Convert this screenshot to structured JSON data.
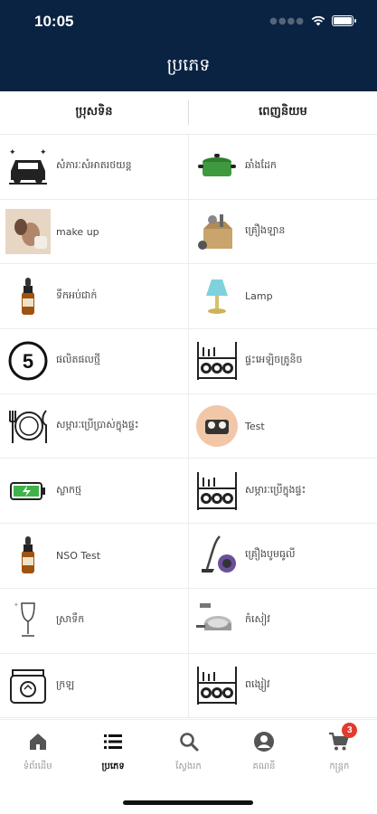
{
  "status_bar": {
    "time": "10:05"
  },
  "header": {
    "title": "ប្រភេទ"
  },
  "tabs": [
    {
      "label": "ប្រុសទិន"
    },
    {
      "label": "ពេញនិយម"
    }
  ],
  "categories": [
    {
      "label": "សំភារៈសំអាតរថយន្ត",
      "icon": "car-wash-icon"
    },
    {
      "label": "ឆាំងដែក",
      "icon": "cooking-pot-icon"
    },
    {
      "label": "make up",
      "icon": "makeup-brush-icon"
    },
    {
      "label": "គ្រឿងឡាន",
      "icon": "car-parts-box-icon"
    },
    {
      "label": "ទឹកអប់ជាក់",
      "icon": "serum-bottle-icon"
    },
    {
      "label": "Lamp",
      "icon": "lamp-icon"
    },
    {
      "label": "ផលិតផលថ្មី",
      "icon": "number-five-icon"
    },
    {
      "label": "ផ្ទះអេឡិចត្រូនិច",
      "icon": "dish-rack-icon"
    },
    {
      "label": "សម្ភារៈប្រើប្រាស់ក្នុងផ្ទះ",
      "icon": "plate-cutlery-icon"
    },
    {
      "label": "Test",
      "icon": "egg-tray-icon"
    },
    {
      "label": "ស្លាកថ្ម",
      "icon": "battery-icon"
    },
    {
      "label": "សម្ភារៈប្រើក្នុងផ្ទះ",
      "icon": "dish-rack-icon"
    },
    {
      "label": "NSO Test",
      "icon": "serum-bottle-icon"
    },
    {
      "label": "គ្រឿងបូមធូលី",
      "icon": "vacuum-cleaner-icon"
    },
    {
      "label": "ស្រាទឹក",
      "icon": "wine-glass-icon"
    },
    {
      "label": "កំសៀវ",
      "icon": "cookware-set-icon"
    },
    {
      "label": "ក្រឡ",
      "icon": "jar-icon"
    },
    {
      "label": "ពង្សៀវ",
      "icon": "dish-rack-icon"
    }
  ],
  "bottom_nav": [
    {
      "label": "ទំព័រដើម",
      "icon": "home-icon"
    },
    {
      "label": "ប្រភេទ",
      "icon": "list-icon",
      "active": true
    },
    {
      "label": "ស្វែងរក",
      "icon": "search-icon"
    },
    {
      "label": "គណនី",
      "icon": "account-icon"
    },
    {
      "label": "កន្ត្រក",
      "icon": "cart-icon",
      "badge": "3"
    }
  ]
}
